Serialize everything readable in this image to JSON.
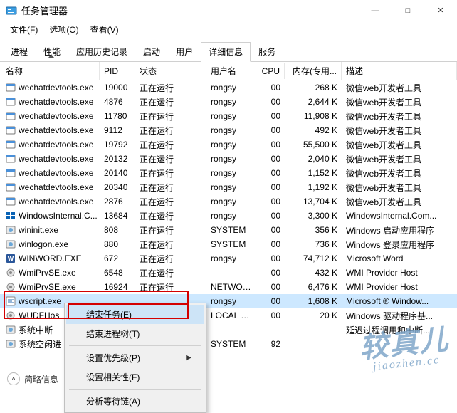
{
  "window": {
    "title": "任务管理器",
    "controls": {
      "min": "—",
      "max": "□",
      "close": "✕"
    }
  },
  "menubar": [
    {
      "label": "文件(F)"
    },
    {
      "label": "选项(O)"
    },
    {
      "label": "查看(V)"
    }
  ],
  "tabs": [
    {
      "label": "进程",
      "active": false
    },
    {
      "label": "性能",
      "active": false
    },
    {
      "label": "应用历史记录",
      "active": false
    },
    {
      "label": "启动",
      "active": false
    },
    {
      "label": "用户",
      "active": false
    },
    {
      "label": "详细信息",
      "active": true
    },
    {
      "label": "服务",
      "active": false
    }
  ],
  "columns": {
    "name": "名称",
    "pid": "PID",
    "status": "状态",
    "user": "用户名",
    "cpu": "CPU",
    "mem": "内存(专用...",
    "desc": "描述"
  },
  "rows": [
    {
      "icon": "app",
      "name": "wechatdevtools.exe",
      "pid": "19000",
      "status": "正在运行",
      "user": "rongsy",
      "cpu": "00",
      "mem": "268 K",
      "desc": "微信web开发者工具"
    },
    {
      "icon": "app",
      "name": "wechatdevtools.exe",
      "pid": "4876",
      "status": "正在运行",
      "user": "rongsy",
      "cpu": "00",
      "mem": "2,644 K",
      "desc": "微信web开发者工具"
    },
    {
      "icon": "app",
      "name": "wechatdevtools.exe",
      "pid": "11780",
      "status": "正在运行",
      "user": "rongsy",
      "cpu": "00",
      "mem": "11,908 K",
      "desc": "微信web开发者工具"
    },
    {
      "icon": "app",
      "name": "wechatdevtools.exe",
      "pid": "9112",
      "status": "正在运行",
      "user": "rongsy",
      "cpu": "00",
      "mem": "492 K",
      "desc": "微信web开发者工具"
    },
    {
      "icon": "app",
      "name": "wechatdevtools.exe",
      "pid": "19792",
      "status": "正在运行",
      "user": "rongsy",
      "cpu": "00",
      "mem": "55,500 K",
      "desc": "微信web开发者工具"
    },
    {
      "icon": "app",
      "name": "wechatdevtools.exe",
      "pid": "20132",
      "status": "正在运行",
      "user": "rongsy",
      "cpu": "00",
      "mem": "2,040 K",
      "desc": "微信web开发者工具"
    },
    {
      "icon": "app",
      "name": "wechatdevtools.exe",
      "pid": "20140",
      "status": "正在运行",
      "user": "rongsy",
      "cpu": "00",
      "mem": "1,152 K",
      "desc": "微信web开发者工具"
    },
    {
      "icon": "app",
      "name": "wechatdevtools.exe",
      "pid": "20340",
      "status": "正在运行",
      "user": "rongsy",
      "cpu": "00",
      "mem": "1,192 K",
      "desc": "微信web开发者工具"
    },
    {
      "icon": "app",
      "name": "wechatdevtools.exe",
      "pid": "2876",
      "status": "正在运行",
      "user": "rongsy",
      "cpu": "00",
      "mem": "13,704 K",
      "desc": "微信web开发者工具"
    },
    {
      "icon": "win",
      "name": "WindowsInternal.C...",
      "pid": "13684",
      "status": "正在运行",
      "user": "rongsy",
      "cpu": "00",
      "mem": "3,300 K",
      "desc": "WindowsInternal.Com..."
    },
    {
      "icon": "sys",
      "name": "wininit.exe",
      "pid": "808",
      "status": "正在运行",
      "user": "SYSTEM",
      "cpu": "00",
      "mem": "356 K",
      "desc": "Windows 启动应用程序"
    },
    {
      "icon": "sys",
      "name": "winlogon.exe",
      "pid": "880",
      "status": "正在运行",
      "user": "SYSTEM",
      "cpu": "00",
      "mem": "736 K",
      "desc": "Windows 登录应用程序"
    },
    {
      "icon": "word",
      "name": "WINWORD.EXE",
      "pid": "672",
      "status": "正在运行",
      "user": "rongsy",
      "cpu": "00",
      "mem": "74,712 K",
      "desc": "Microsoft Word"
    },
    {
      "icon": "svc",
      "name": "WmiPrvSE.exe",
      "pid": "6548",
      "status": "正在运行",
      "user": "",
      "cpu": "00",
      "mem": "432 K",
      "desc": "WMI Provider Host"
    },
    {
      "icon": "svc",
      "name": "WmiPrvSE.exe",
      "pid": "16924",
      "status": "正在运行",
      "user": "NETWOR...",
      "cpu": "00",
      "mem": "6,476 K",
      "desc": "WMI Provider Host"
    },
    {
      "icon": "script",
      "name": "wscript.exe",
      "pid": "",
      "status": "",
      "user": "rongsy",
      "cpu": "00",
      "mem": "1,608 K",
      "desc": "Microsoft ® Window...",
      "selected": true
    },
    {
      "icon": "svc",
      "name": "WUDFHos",
      "pid": "",
      "status": "",
      "user": "LOCAL SE...",
      "cpu": "00",
      "mem": "20 K",
      "desc": "Windows 驱动程序基..."
    },
    {
      "icon": "sys",
      "name": "系统中断",
      "pid": "",
      "status": "",
      "user": "",
      "cpu": "",
      "mem": "",
      "desc": "延迟过程调用和中断..."
    },
    {
      "icon": "sys",
      "name": "系统空闲进",
      "pid": "",
      "status": "",
      "user": "SYSTEM",
      "cpu": "92",
      "mem": "",
      "desc": ""
    }
  ],
  "context_menu": [
    {
      "label": "结束任务(E)",
      "highlight": true
    },
    {
      "label": "结束进程树(T)"
    },
    {
      "sep": true
    },
    {
      "label": "设置优先级(P)",
      "submenu": true
    },
    {
      "label": "设置相关性(F)"
    },
    {
      "sep": true
    },
    {
      "label": "分析等待链(A)"
    }
  ],
  "footer": {
    "label": "简略信息"
  },
  "watermark": {
    "big": "较真儿",
    "small": "jiaozhen.cc"
  },
  "colors": {
    "selection": "#cde8ff",
    "menu_hover": "#cde4f7",
    "red_box": "#d40000",
    "watermark": "#7fa6c9"
  }
}
